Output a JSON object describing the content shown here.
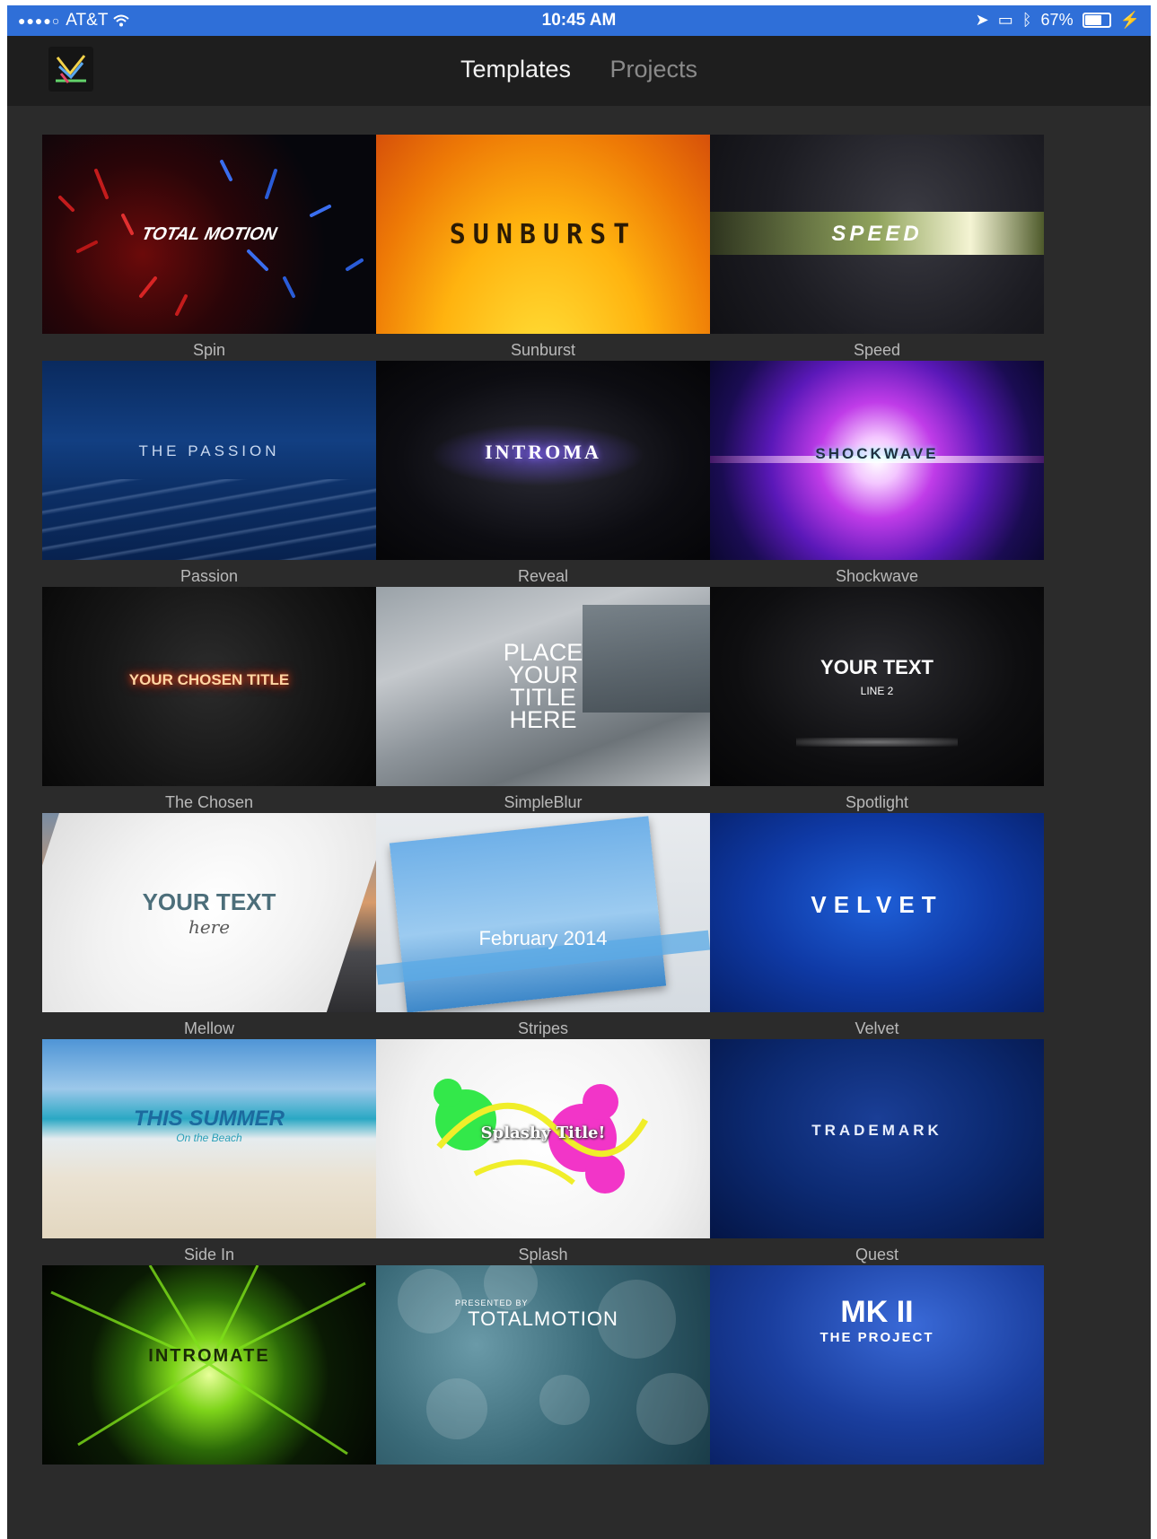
{
  "status_bar": {
    "carrier": "AT&T",
    "time": "10:45 AM",
    "battery": "67%"
  },
  "nav": {
    "tabs": [
      {
        "label": "Templates",
        "active": true
      },
      {
        "label": "Projects",
        "active": false
      }
    ]
  },
  "templates": [
    {
      "name": "Spin",
      "thumb_text": "TOTAL MOTION"
    },
    {
      "name": "Sunburst",
      "thumb_text": "SUNBURST"
    },
    {
      "name": "Speed",
      "thumb_text": "SPEED"
    },
    {
      "name": "Passion",
      "thumb_text": "THE PASSION"
    },
    {
      "name": "Reveal",
      "thumb_text": "INTROMA"
    },
    {
      "name": "Shockwave",
      "thumb_text": "SHOCKWAVE"
    },
    {
      "name": "The Chosen",
      "thumb_text": "YOUR CHOSEN TITLE"
    },
    {
      "name": "SimpleBlur",
      "thumb_text": "PLACE YOUR TITLE HERE"
    },
    {
      "name": "Spotlight",
      "thumb_text": "YOUR TEXT",
      "thumb_subtext": "LINE 2"
    },
    {
      "name": "Mellow",
      "thumb_text": "YOUR TEXT",
      "thumb_subtext": "here"
    },
    {
      "name": "Stripes",
      "thumb_text": "February 2014"
    },
    {
      "name": "Velvet",
      "thumb_text": "VELVET"
    },
    {
      "name": "Side In",
      "thumb_text": "THIS SUMMER",
      "thumb_subtext": "On the Beach"
    },
    {
      "name": "Splash",
      "thumb_text": "Splashy Title!"
    },
    {
      "name": "Quest",
      "thumb_text": "TRADEMARK"
    },
    {
      "name": "",
      "thumb_text": "INTROMATE"
    },
    {
      "name": "",
      "thumb_text": "TOTALMOTION",
      "thumb_subtext": "PRESENTED BY"
    },
    {
      "name": "",
      "thumb_text": "MK II",
      "thumb_subtext": "THE PROJECT"
    }
  ],
  "colors": {
    "status_bar": "#2f6fd8",
    "background": "#2b2b2b",
    "navbar": "#1e1e1e"
  }
}
